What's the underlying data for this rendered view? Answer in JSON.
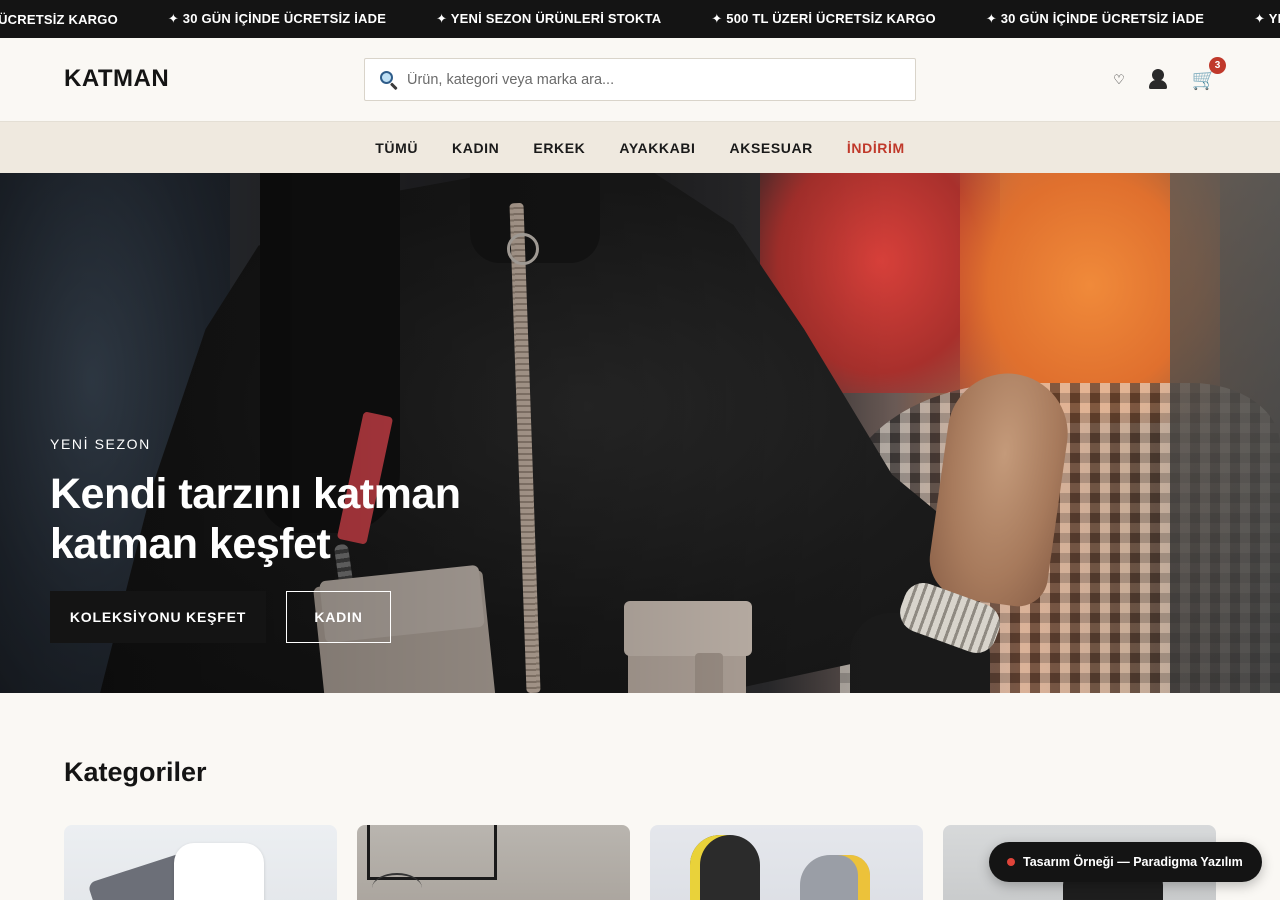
{
  "ticker": {
    "items": [
      "ERİ ÜCRETSİZ KARGO",
      "✦ 30 GÜN İÇİNDE ÜCRETSİZ İADE",
      "✦ YENİ SEZON ÜRÜNLERİ STOKTA",
      "✦ 500 TL ÜZERİ ÜCRETSİZ KARGO",
      "✦ 30 GÜN İÇİNDE ÜCRETSİZ İADE",
      "✦ YENİ"
    ]
  },
  "header": {
    "logo": "KATMAN",
    "search_placeholder": "Ürün, kategori veya marka ara...",
    "cart_count": "3",
    "icons": [
      "search-icon",
      "heart-icon",
      "user-icon",
      "cart-icon"
    ]
  },
  "nav": {
    "items": [
      "TÜMÜ",
      "KADIN",
      "ERKEK",
      "AYAKKABI",
      "AKSESUAR",
      "İNDİRİM"
    ]
  },
  "hero": {
    "eyebrow": "YENİ SEZON",
    "title": "Kendi tarzını katman katman keşfet",
    "primary_button": "KOLEKSİYONU KEŞFET",
    "secondary_button": "KADIN"
  },
  "categories": {
    "title": "Kategoriler"
  },
  "badge": {
    "label": "Tasarım Örneği — Paradigma Yazılım"
  },
  "colors": {
    "accent": "#c0392b",
    "dark": "#141414",
    "page_bg": "#faf8f4",
    "nav_bg": "#efe9df"
  }
}
